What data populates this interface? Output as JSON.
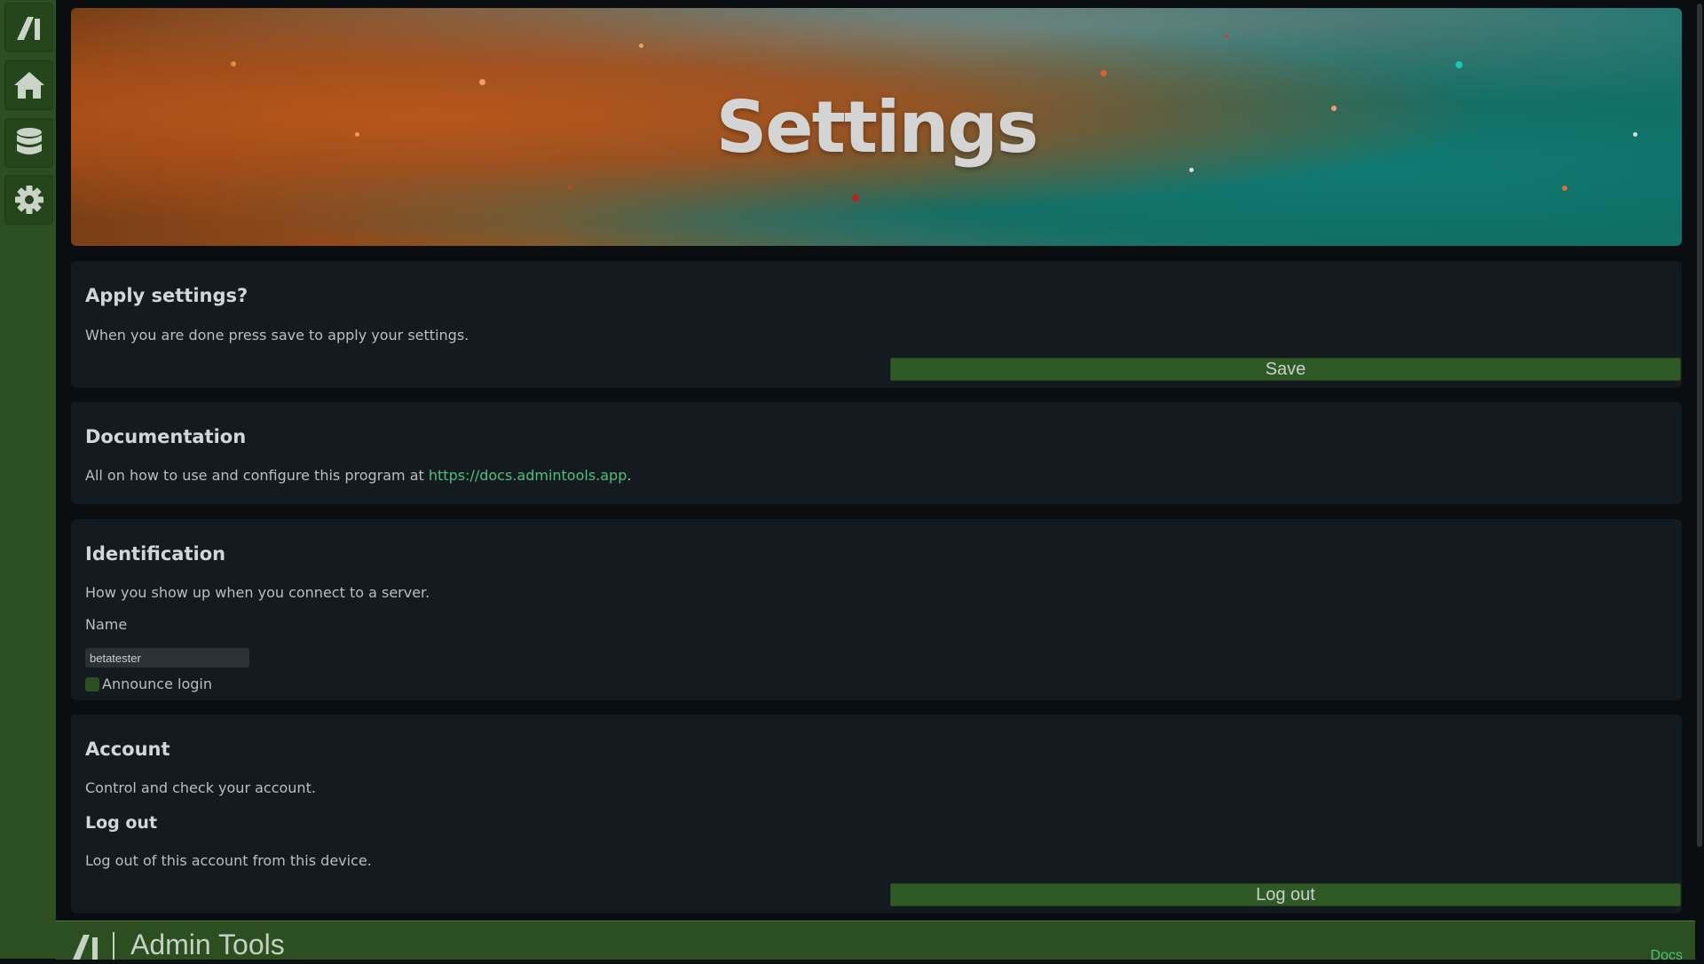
{
  "sidebar": {
    "items": [
      {
        "icon": "logo-icon"
      },
      {
        "icon": "home-icon"
      },
      {
        "icon": "database-icon"
      },
      {
        "icon": "gear-icon"
      }
    ]
  },
  "banner": {
    "title": "Settings"
  },
  "apply": {
    "heading": "Apply settings?",
    "description": "When you are done press save to apply your settings.",
    "save_label": "Save"
  },
  "documentation": {
    "heading": "Documentation",
    "description_prefix": "All on how to use and configure this program at ",
    "link_text": "https://docs.admintools.app",
    "description_suffix": "."
  },
  "identification": {
    "heading": "Identification",
    "description": "How you show up when you connect to a server.",
    "name_label": "Name",
    "name_value": "betatester",
    "announce_label": "Announce login"
  },
  "account": {
    "heading": "Account",
    "description": "Control and check your account.",
    "logout_heading": "Log out",
    "logout_description": "Log out of this account from this device.",
    "logout_label": "Log out"
  },
  "footer": {
    "brand": "Admin Tools",
    "docs_link": "Docs"
  },
  "colors": {
    "sidebar": "#2c4f22",
    "card": "#141b20",
    "accent_link": "#4fc17a",
    "button": "#2f5a26"
  }
}
